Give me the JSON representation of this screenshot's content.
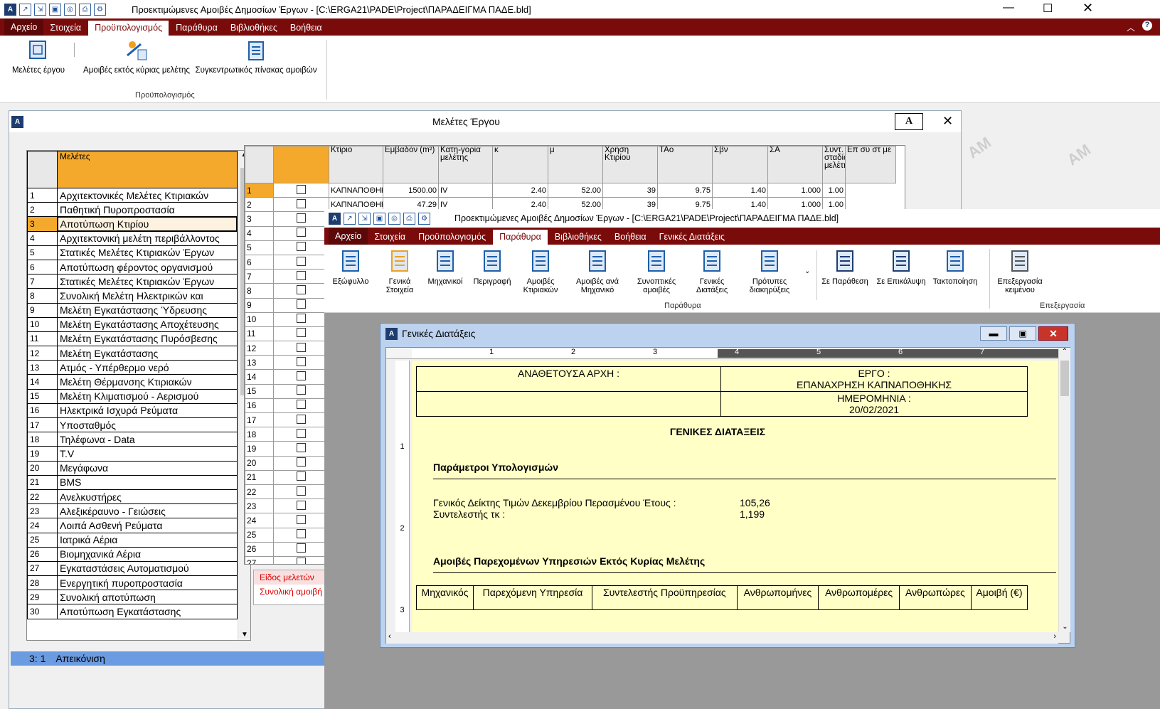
{
  "app1": {
    "title": "Προεκτιμώμενες Αμοιβές Δημοσίων Έργων - [C:\\ERGA21\\PADE\\Project\\ΠΑΡΑΔΕΙΓΜΑ ΠΑΔΕ.bld]",
    "menu": [
      "Αρχείο",
      "Στοιχεία",
      "Προϋπολογισμός",
      "Παράθυρα",
      "Βιβλιοθήκες",
      "Βοήθεια"
    ],
    "ribbon": {
      "btn1": "Μελέτες έργου",
      "btn2": "Αμοιβές εκτός κύριας μελέτης",
      "btn3": "Συγκεντρωτικός πίνακας αμοιβών",
      "group": "Προϋπολογισμός"
    }
  },
  "melet": {
    "title": "Μελέτες Έργου",
    "header": "Μελέτες",
    "rows": [
      "Αρχιτεκτονικές Μελέτες Κτιριακών",
      "Παθητική Πυροπροστασία",
      "Αποτύπωση Κτιρίου",
      "Αρχιτεκτονική μελέτη περιβάλλοντος",
      "Στατικές Μελέτες Κτιριακών Έργων",
      "Αποτύπωση φέροντος οργανισμού",
      "Στατικές Μελέτες Κτιριακών Έργων",
      "Συνολική Μελέτη Ηλεκτρικών και",
      "Μελέτη Εγκατάστασης Ύδρευσης",
      "Μελέτη Εγκατάστασης Αποχέτευσης",
      "Μελέτη Εγκατάστασης Πυρόσβεσης",
      "Μελέτη Εγκατάστασης",
      "Ατμός - Υπέρθερμο νερό",
      "Μελέτη Θέρμανσης Κτιριακών",
      "Μελέτη Κλιματισμού - Αερισμού",
      "Ηλεκτρικά Ισχυρά Ρεύματα",
      "Υποσταθμός",
      "Τηλέφωνα - Data",
      "T.V",
      "Μεγάφωνα",
      "BMS",
      "Ανελκυστήρες",
      "Αλεξικέραυνο - Γειώσεις",
      "Λοιπά Ασθενή Ρεύματα",
      "Ιατρικά Αέρια",
      "Βιομηχανικά Αέρια",
      "Εγκαταστάσεις Αυτοματισμού",
      "Ενεργητική πυροπροστασία",
      "Συνολική αποτύπωση",
      "Αποτύπωση Εγκατάστασης"
    ],
    "cols": [
      "Κτίριο",
      "Εμβαδόν (m²)",
      "Κατη-γορία μελέτης",
      "κ",
      "μ",
      "Χρήση Κτιρίου",
      "ΤΑο",
      "Σβν",
      "ΣΑ",
      "Συντ. σταδίων μελέτης",
      "Επ συ στ με"
    ],
    "data": [
      [
        "ΚΑΠΝΑΠΟΘΗΚΗ",
        "1500.00",
        "IV",
        "2.40",
        "52.00",
        "39",
        "9.75",
        "1.40",
        "1.000",
        "1.00"
      ],
      [
        "ΚΑΠΝΑΠΟΘΗΚΗ",
        "47.29",
        "IV",
        "2.40",
        "52.00",
        "39",
        "9.75",
        "1.40",
        "1.000",
        "1.00"
      ]
    ],
    "side_links": [
      "Είδος μελετών",
      "Συνολική αμοιβή"
    ],
    "status": [
      "3: 1",
      "Απεικόνιση"
    ]
  },
  "app2": {
    "title": "Προεκτιμώμενες Αμοιβές Δημοσίων Έργων - [C:\\ERGA21\\PADE\\Project\\ΠΑΡΑΔΕΙΓΜΑ ΠΑΔΕ.bld]",
    "menu": [
      "Αρχείο",
      "Στοιχεία",
      "Προϋπολογισμός",
      "Παράθυρα",
      "Βιβλιοθήκες",
      "Βοήθεια",
      "Γενικές Διατάξεις"
    ],
    "ribbon": [
      "Εξώφυλλο",
      "Γενικά Στοιχεία",
      "Μηχανικοί",
      "Περιγραφή",
      "Αμοιβές Κτιριακών",
      "Αμοιβές ανά Μηχανικό",
      "Συνοπτικές αμοιβές",
      "Γενικές Διατάξεις",
      "Πρότυπες διακηρύξεις",
      "Σε Παράθεση",
      "Σε Επικάλυψη",
      "Τακτοποίηση",
      "Επεξεργασία κειμένου"
    ],
    "group1": "Παράθυρα",
    "group2": "Επεξεργασία"
  },
  "doc": {
    "title": "Γενικές Διατάξεις",
    "ruler": [
      "1",
      "2",
      "3",
      "4",
      "5",
      "6",
      "7"
    ],
    "anath": "ΑΝΑΘΕΤΟΥΣΑ ΑΡΧΗ :",
    "ergo_l": "ΕΡΓΟ :",
    "ergo_v": "ΕΠΑΝΑΧΡΗΣΗ ΚΑΠΝΑΠΟΘΗΚΗΣ",
    "date_l": "ΗΜΕΡΟΜΗΝΙΑ :",
    "date_v": "20/02/2021",
    "heading": "ΓΕΝΙΚΕΣ ΔΙΑΤΑΞΕΙΣ",
    "sec1": "Παράμετροι Υπολογισμών",
    "p1_l": "Γενικός Δείκτης Τιμών Δεκεμβρίου Περασμένου Έτους :",
    "p1_v": "105,26",
    "p2_l": "Συντελεστής τκ :",
    "p2_v": "1,199",
    "sec2": "Αμοιβές Παρεχομένων Υπηρεσιών Εκτός Κυρίας Μελέτης",
    "table_cols": [
      "Μηχανικός",
      "Παρεχόμενη Υπηρεσία",
      "Συντελεστής Προϋπηρεσίας",
      "Ανθρωπομήνες",
      "Ανθρωπομέρες",
      "Ανθρωπώρες",
      "Αμοιβή (€)"
    ]
  }
}
